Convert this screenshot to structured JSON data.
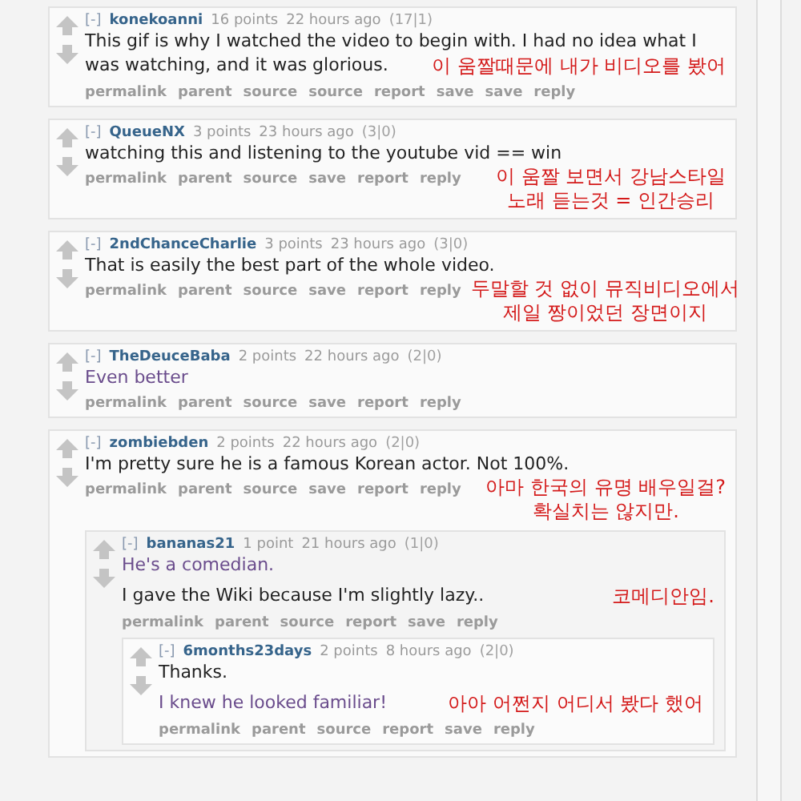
{
  "comments": [
    {
      "toggle": "[-]",
      "user": "konekoanni",
      "points": "16 points",
      "time": "22 hours ago",
      "votes": "(17|1)",
      "body": [
        {
          "kind": "plain",
          "text": "This gif is why I watched the video to begin with. I had no idea what I"
        },
        {
          "kind": "plain",
          "text": "was watching, and it was glorious."
        }
      ],
      "actions": [
        "permalink",
        "parent",
        "source",
        "source",
        "report",
        "save",
        "save",
        "reply"
      ],
      "annotation": {
        "kind": "body",
        "lines": [
          "이 움짤때문에 내가 비디오를 봤어"
        ]
      }
    },
    {
      "toggle": "[-]",
      "user": "QueueNX",
      "points": "3 points",
      "time": "23 hours ago",
      "votes": "(3|0)",
      "body": [
        {
          "kind": "plain",
          "text": "watching this and listening to the youtube vid == win"
        }
      ],
      "actions": [
        "permalink",
        "parent",
        "source",
        "save",
        "report",
        "reply"
      ],
      "annotation": {
        "kind": "actions",
        "lines": [
          "이 움짤 보면서 강남스타일",
          "노래 듣는것 = 인간승리"
        ]
      }
    },
    {
      "toggle": "[-]",
      "user": "2ndChanceCharlie",
      "points": "3 points",
      "time": "23 hours ago",
      "votes": "(3|0)",
      "body": [
        {
          "kind": "plain",
          "text": "That is easily the best part of the whole video."
        }
      ],
      "actions": [
        "permalink",
        "parent",
        "source",
        "save",
        "report",
        "reply"
      ],
      "annotation": {
        "kind": "actions",
        "lines": [
          "두말할 것 없이 뮤직비디오에서",
          "제일 짱이었던 장면이지"
        ]
      }
    },
    {
      "toggle": "[-]",
      "user": "TheDeuceBaba",
      "points": "2 points",
      "time": "22 hours ago",
      "votes": "(2|0)",
      "body": [
        {
          "kind": "accent",
          "text": "Even better"
        }
      ],
      "actions": [
        "permalink",
        "parent",
        "source",
        "save",
        "report",
        "reply"
      ]
    },
    {
      "toggle": "[-]",
      "user": "zombiebden",
      "points": "2 points",
      "time": "22 hours ago",
      "votes": "(2|0)",
      "body": [
        {
          "kind": "plain",
          "text": "I'm pretty sure he is a famous Korean actor. Not 100%."
        }
      ],
      "actions": [
        "permalink",
        "parent",
        "source",
        "save",
        "report",
        "reply"
      ],
      "annotation": {
        "kind": "actions",
        "lines": [
          "아마 한국의 유명 배우일걸?",
          "확실치는 않지만."
        ]
      },
      "children": [
        {
          "toggle": "[-]",
          "user": "bananas21",
          "points": "1 point",
          "time": "21 hours ago",
          "votes": "(1|0)",
          "body": [
            {
              "kind": "accent",
              "text": "He's a comedian."
            },
            {
              "kind": "plain",
              "text": "I gave the Wiki because I'm slightly lazy.."
            }
          ],
          "actions": [
            "permalink",
            "parent",
            "source",
            "report",
            "save",
            "reply"
          ],
          "annotation": {
            "kind": "body",
            "lines": [
              "코메디안임."
            ]
          },
          "children": [
            {
              "toggle": "[-]",
              "user": "6months23days",
              "points": "2 points",
              "time": "8 hours ago",
              "votes": "(2|0)",
              "body": [
                {
                  "kind": "plain",
                  "text": "Thanks."
                },
                {
                  "kind": "accent",
                  "text": "I knew he looked familiar!"
                }
              ],
              "actions": [
                "permalink",
                "parent",
                "source",
                "report",
                "save",
                "reply"
              ],
              "annotation": {
                "kind": "body",
                "lines": [
                  "아아 어쩐지 어디서 봤다 했어"
                ]
              }
            }
          ]
        }
      ]
    }
  ]
}
